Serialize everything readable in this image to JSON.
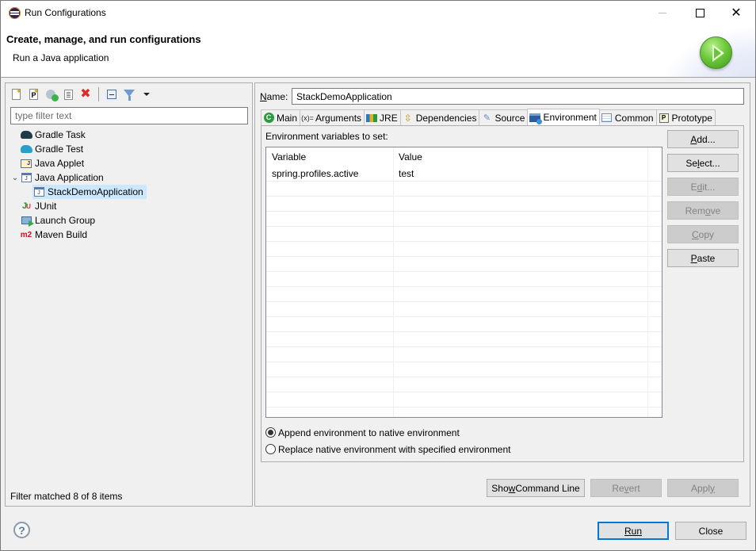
{
  "window": {
    "title": "Run Configurations",
    "controls": {
      "minimize": "minimize",
      "maximize": "maximize",
      "close": "close"
    }
  },
  "header": {
    "title": "Create, manage, and run configurations",
    "message": "Run a Java application",
    "icon": "run-play-icon"
  },
  "left_panel": {
    "toolbar": [
      {
        "name": "new-launch-configuration",
        "icon": "new-config-icon"
      },
      {
        "name": "new-prototype",
        "icon": "new-prototype-icon"
      },
      {
        "name": "export-launch-configuration",
        "icon": "export-icon"
      },
      {
        "name": "duplicate",
        "icon": "duplicate-icon"
      },
      {
        "name": "delete",
        "icon": "delete-icon"
      },
      {
        "name": "collapse-all",
        "icon": "collapse-all-icon"
      },
      {
        "name": "filter",
        "icon": "filter-icon"
      },
      {
        "name": "view-menu",
        "icon": "chevron-down-icon"
      }
    ],
    "filter_placeholder": "type filter text",
    "filter_value": "",
    "tree": [
      {
        "label": "Gradle Task",
        "icon": "gradle-task-icon",
        "level": 0
      },
      {
        "label": "Gradle Test",
        "icon": "gradle-test-icon",
        "level": 0
      },
      {
        "label": "Java Applet",
        "icon": "java-applet-icon",
        "level": 0
      },
      {
        "label": "Java Application",
        "icon": "java-application-icon",
        "level": 0,
        "expanded": true
      },
      {
        "label": "StackDemoApplication",
        "icon": "java-application-icon",
        "level": 1,
        "selected": true
      },
      {
        "label": "JUnit",
        "icon": "junit-icon",
        "level": 0
      },
      {
        "label": "Launch Group",
        "icon": "launch-group-icon",
        "level": 0
      },
      {
        "label": "Maven Build",
        "icon": "maven-icon",
        "level": 0
      }
    ],
    "status": "Filter matched 8 of 8 items"
  },
  "right_panel": {
    "name_label": "Name:",
    "name_value": "StackDemoApplication",
    "tabs": [
      {
        "label": "Main",
        "icon": "main-icon",
        "active": false
      },
      {
        "label": "Arguments",
        "icon": "arguments-icon",
        "active": false
      },
      {
        "label": "JRE",
        "icon": "jre-icon",
        "active": false
      },
      {
        "label": "Dependencies",
        "icon": "dependencies-icon",
        "active": false
      },
      {
        "label": "Source",
        "icon": "source-icon",
        "active": false
      },
      {
        "label": "Environment",
        "icon": "environment-icon",
        "active": true
      },
      {
        "label": "Common",
        "icon": "common-icon",
        "active": false
      },
      {
        "label": "Prototype",
        "icon": "prototype-icon",
        "active": false
      }
    ],
    "environment": {
      "label": "Environment variables to set:",
      "columns": [
        "Variable",
        "Value"
      ],
      "rows": [
        {
          "variable": "spring.profiles.active",
          "value": "test"
        }
      ],
      "buttons": {
        "add": {
          "label": "Add...",
          "enabled": true
        },
        "select": {
          "label": "Select...",
          "enabled": true
        },
        "edit": {
          "label": "Edit...",
          "enabled": false
        },
        "remove": {
          "label": "Remove",
          "enabled": false
        },
        "copy": {
          "label": "Copy",
          "enabled": false
        },
        "paste": {
          "label": "Paste",
          "enabled": true
        }
      },
      "radio_options": [
        {
          "label": "Append environment to native environment",
          "checked": true
        },
        {
          "label": "Replace native environment with specified environment",
          "checked": false
        }
      ]
    },
    "bottom_buttons": {
      "show_command_line": {
        "label": "Show Command Line",
        "enabled": true
      },
      "revert": {
        "label": "Revert",
        "enabled": false
      },
      "apply": {
        "label": "Apply",
        "enabled": false
      }
    }
  },
  "footer": {
    "help_icon": "help-icon",
    "run": {
      "label": "Run",
      "default": true
    },
    "close": {
      "label": "Close"
    }
  },
  "colors": {
    "selection": "#cce8ff",
    "default_button_border": "#0078d7",
    "disabled_text": "#838383"
  }
}
